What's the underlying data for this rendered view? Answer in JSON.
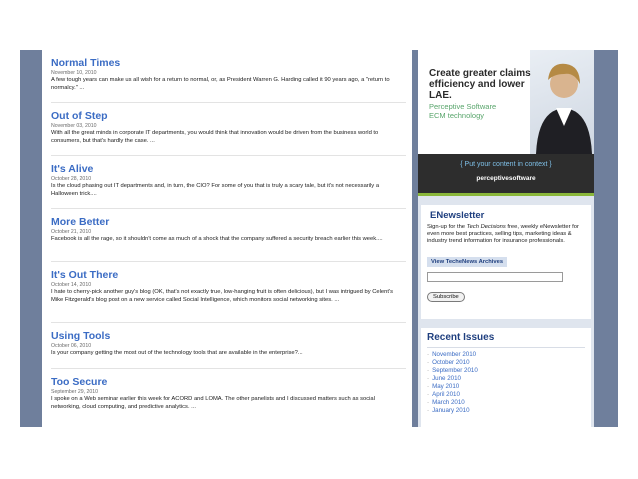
{
  "posts": [
    {
      "title": "Normal Times",
      "date": "November 10, 2010",
      "excerpt": "A few tough years can make us all wish for a return to normal, or, as President Warren G. Harding called it 90 years ago, a \"return to normalcy.\" ..."
    },
    {
      "title": "Out of Step",
      "date": "November 03, 2010",
      "excerpt": "With all the great minds in corporate IT departments, you would think that innovation would be driven from the business world to consumers, but that's hardly the case. ..."
    },
    {
      "title": "It's Alive",
      "date": "October 28, 2010",
      "excerpt": "Is the cloud phasing out IT departments and, in turn, the CIO? For some of you that is truly a scary tale, but it's not necessarily a Halloween trick...."
    },
    {
      "title": "More Better",
      "date": "October 21, 2010",
      "excerpt": "Facebook is all the rage, so it shouldn't come as much of a shock that the company suffered a security breach earlier this week...."
    },
    {
      "title": "It's Out There",
      "date": "October 14, 2010",
      "excerpt": "I hate to cherry-pick another guy's blog (OK, that's not exactly true, low-hanging fruit is often delicious), but I was intrigued by Celent's Mike Fitzgerald's blog post on a new service called Social Intelligence, which monitors social networking sites. ..."
    },
    {
      "title": "Using Tools",
      "date": "October 06, 2010",
      "excerpt": "Is your company getting the most out of the technology tools that are available in the enterprise?..."
    },
    {
      "title": "Too Secure",
      "date": "September 29, 2010",
      "excerpt": "I spoke on a Web seminar earlier this week for ACORD and LOMA. The other panelists and I discussed matters such as social networking, cloud computing, and predictive analytics. ..."
    }
  ],
  "ad": {
    "headline": "Create greater claims efficiency and lower LAE.",
    "sub1": "Perceptive Software",
    "sub2": "ECM technology",
    "cta": "{ Put your content in context }",
    "brand": "perceptivesoftware"
  },
  "enewsletter": {
    "title": "ENewsletter",
    "text_before": "Sign-up for the ",
    "text_em": "Tech Decisions",
    "text_after": " free, weekly eNewsletter for even more best practices, selling tips, marketing ideas & industry trend information for insurance professionals.",
    "archive_label": "View TecheNews Archives",
    "subscribe_label": "Subscribe"
  },
  "recent": {
    "title": "Recent Issues",
    "items": [
      "November 2010",
      "October 2010",
      "September 2010",
      "June 2010",
      "May 2010",
      "April 2010",
      "March 2010",
      "January 2010"
    ]
  }
}
